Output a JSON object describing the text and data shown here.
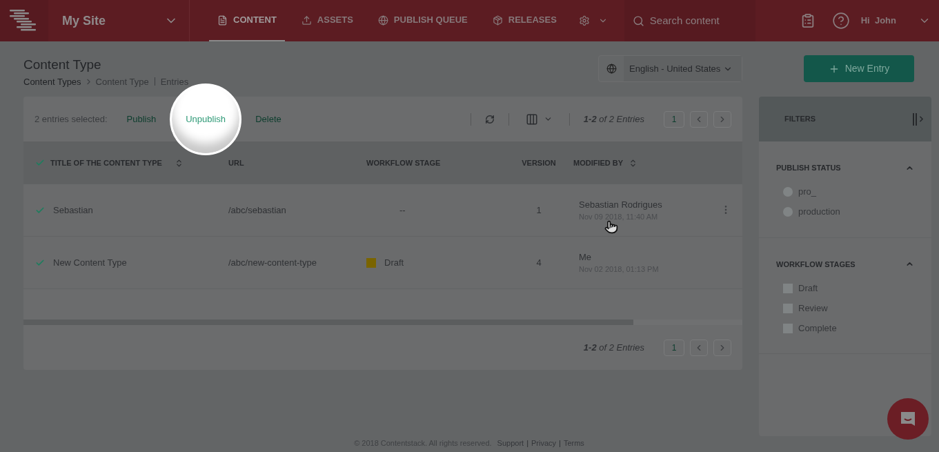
{
  "header": {
    "site": "My Site",
    "nav": [
      {
        "label": "CONTENT",
        "selected": true
      },
      {
        "label": "ASSETS",
        "selected": false
      },
      {
        "label": "PUBLISH QUEUE",
        "selected": false
      },
      {
        "label": "RELEASES",
        "selected": false
      }
    ],
    "search": {
      "placeholder": "Search content"
    },
    "greeting": "Hi  John"
  },
  "page": {
    "title": "Content Type",
    "breadcrumbs": [
      {
        "label": "Content Types",
        "kind": "link"
      },
      {
        "label": "Content Type",
        "kind": "current"
      },
      {
        "label": "Entries",
        "kind": "current"
      }
    ],
    "locale": "English - United States",
    "new_entry": "New Entry"
  },
  "toolbar": {
    "selection": "2 entries selected:",
    "actions": [
      {
        "label": "Publish",
        "highlighted": false
      },
      {
        "label": "Unpublish",
        "highlighted": true
      },
      {
        "label": "Delete",
        "highlighted": false
      }
    ],
    "pagination": {
      "summary": "**1-2** of 2 Entries",
      "page": "1"
    }
  },
  "table": {
    "all_checked": true,
    "columns": [
      {
        "label": "TITLE OF THE CONTENT TYPE",
        "sortable": true
      },
      {
        "label": "URL",
        "sortable": false
      },
      {
        "label": "WORKFLOW STAGE",
        "sortable": false
      },
      {
        "label": "VERSION",
        "sortable": false
      },
      {
        "label": "MODIFIED BY",
        "sortable": true
      }
    ],
    "rows": [
      {
        "checked": true,
        "title": "Sebastian",
        "url": "/abc/sebastian",
        "stage": {
          "label": "--"
        },
        "version": "1",
        "modified_by": "Sebastian Rodrigues",
        "modified_at": "Nov 09 2018, 11:40 AM",
        "hovered": true
      },
      {
        "checked": true,
        "title": "New Content Type",
        "url": "/abc/new-content-type",
        "stage": {
          "label": "Draft",
          "color": "#7a6400"
        },
        "version": "4",
        "modified_by": "Me",
        "modified_at": "Nov 02 2018, 01:13 PM",
        "hovered": false
      }
    ]
  },
  "bottom_pagination": {
    "summary": "**1-2** of 2 Entries",
    "page": "1"
  },
  "filters": {
    "title": "FILTERS",
    "sections": [
      {
        "title": "PUBLISH STATUS",
        "expanded": true,
        "kind": "radio",
        "options": [
          {
            "label": "pro_",
            "checked": false
          },
          {
            "label": "production",
            "checked": false
          }
        ]
      },
      {
        "title": "WORKFLOW STAGES",
        "expanded": true,
        "kind": "checkbox",
        "options": [
          {
            "label": "Draft",
            "checked": false
          },
          {
            "label": "Review",
            "checked": false
          },
          {
            "label": "Complete",
            "checked": false
          }
        ]
      }
    ]
  },
  "footer": [
    {
      "kind": "text",
      "text": "© 2018 Contentstack. All rights reserved."
    },
    {
      "kind": "link",
      "text": "Support"
    },
    {
      "kind": "separator",
      "text": "|"
    },
    {
      "kind": "link",
      "text": "Privacy"
    },
    {
      "kind": "separator",
      "text": "|"
    },
    {
      "kind": "link",
      "text": "Terms"
    }
  ]
}
